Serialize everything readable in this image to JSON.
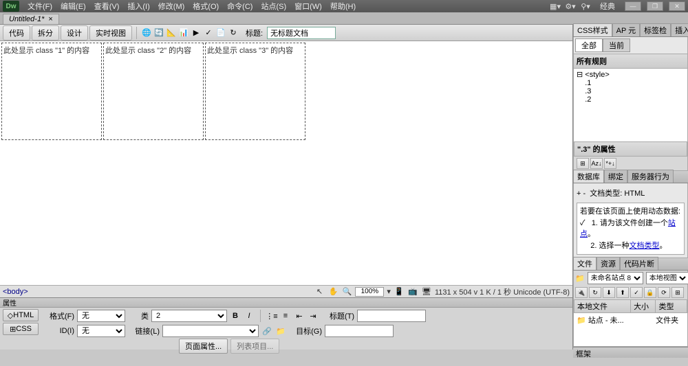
{
  "titlebar": {
    "logo": "Dw",
    "menus": [
      "文件(F)",
      "编辑(E)",
      "查看(V)",
      "插入(I)",
      "修改(M)",
      "格式(O)",
      "命令(C)",
      "站点(S)",
      "窗口(W)",
      "帮助(H)"
    ],
    "workspace": "经典"
  },
  "doctab": {
    "name": "Untitled-1*"
  },
  "toolbar": {
    "views": [
      "代码",
      "拆分",
      "设计",
      "实时视图"
    ],
    "title_label": "标题:",
    "title_value": "无标题文档"
  },
  "design": {
    "boxes": [
      "此处显示 class \"1\" 的内容",
      "此处显示 class \"2\" 的内容",
      "此处显示 class \"3\" 的内容"
    ]
  },
  "tagbar": {
    "tag": "<body>",
    "zoom": "100%",
    "dims": "1131 x 504 v  1 K / 1 秒 Unicode (UTF-8)"
  },
  "props": {
    "header": "属性",
    "side_html": "HTML",
    "side_css": "CSS",
    "format_label": "格式(F)",
    "format_value": "无",
    "id_label": "ID(I)",
    "id_value": "无",
    "class_label": "类",
    "class_value": "2",
    "link_label": "链接(L)",
    "title_label": "标题(T)",
    "target_label": "目标(G)",
    "page_props": "页面属性...",
    "list_items": "列表项目..."
  },
  "css_panel": {
    "tabs": [
      "CSS样式",
      "AP 元",
      "标签检",
      "插入"
    ],
    "subtabs": [
      "全部",
      "当前"
    ],
    "rules_label": "所有规则",
    "tree": [
      "⊟ <style>",
      "    .1",
      "    .3",
      "    .2"
    ],
    "attr_label": "\".3\" 的属性"
  },
  "db_panel": {
    "tabs": [
      "数据库",
      "绑定",
      "服务器行为"
    ],
    "doc_type": "文档类型: HTML",
    "info_header": "若要在该页面上使用动态数据:",
    "info1_pre": "1. 请为该文件创建一个",
    "info1_link": "站点",
    "info2_pre": "2. 选择一种",
    "info2_link": "文档类型"
  },
  "files_panel": {
    "tabs": [
      "文件",
      "资源",
      "代码片断"
    ],
    "site": "未命名站点 8",
    "view": "本地视图",
    "cols": [
      "本地文件",
      "大小",
      "类型"
    ],
    "row_name": "站点 - 未...",
    "row_type": "文件夹"
  },
  "frame_panel": {
    "label": "框架"
  }
}
